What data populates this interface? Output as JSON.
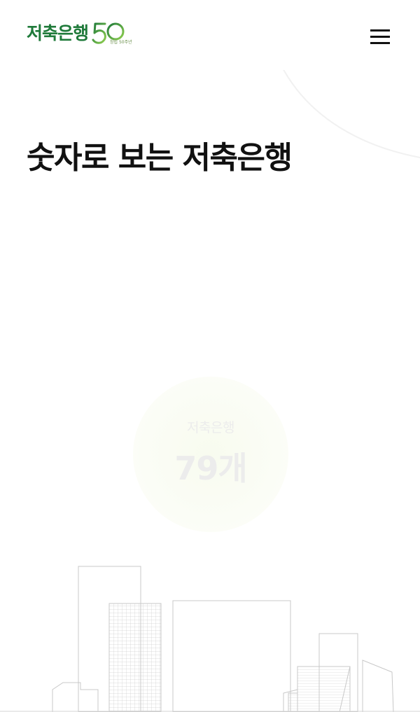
{
  "header": {
    "logo_text": "저축은행",
    "logo_badge": "50",
    "logo_badge_sub": "창립 50주년",
    "menu_icon": "hamburger-menu-icon"
  },
  "main": {
    "title": "숫자로 보는 저축은행",
    "stat": {
      "label": "저축은행",
      "value": "79개"
    }
  },
  "colors": {
    "brand_green": "#1f7a3a",
    "brand_light_green": "#8fcf4f",
    "title_text": "#111111",
    "faded_text": "#ececec",
    "skyline_line": "#c8c8c8"
  }
}
